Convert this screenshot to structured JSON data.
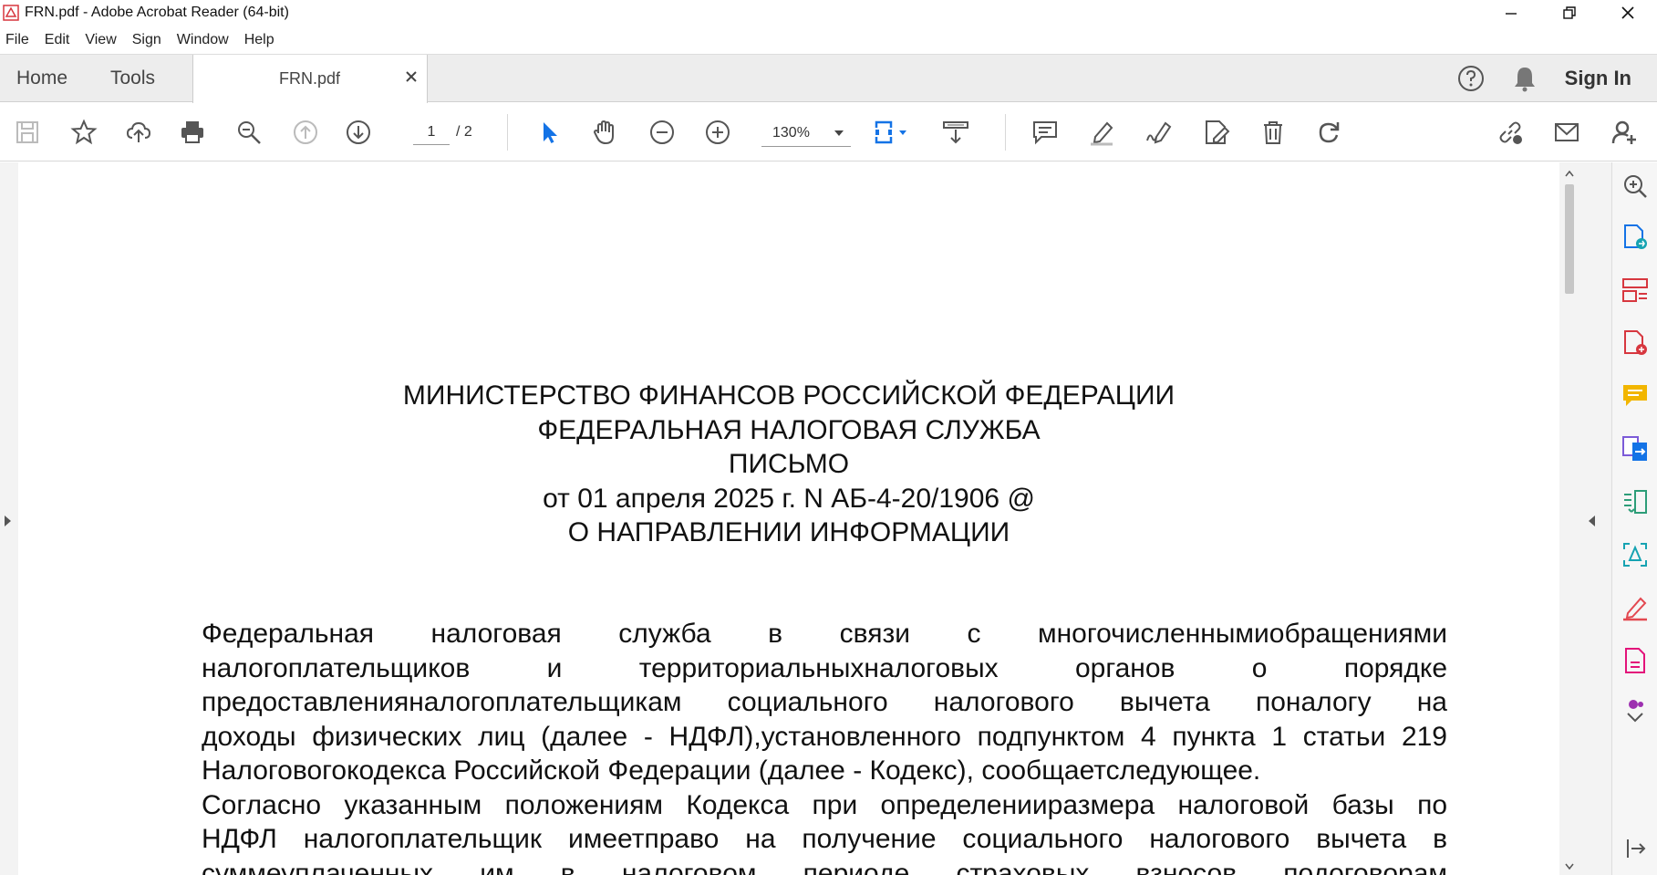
{
  "window": {
    "title": "FRN.pdf - Adobe Acrobat Reader (64-bit)"
  },
  "menu": [
    "File",
    "Edit",
    "View",
    "Sign",
    "Window",
    "Help"
  ],
  "tabs": {
    "home": "Home",
    "tools": "Tools",
    "document": "FRN.pdf",
    "sign_in": "Sign In"
  },
  "toolbar": {
    "page_current": "1",
    "page_total": "/ 2",
    "zoom": "130%"
  },
  "document": {
    "heading_lines": [
      "МИНИСТЕРСТВО ФИНАНСОВ РОССИЙСКОЙ ФЕДЕРАЦИИ",
      "ФЕДЕРАЛЬНАЯ НАЛОГОВАЯ СЛУЖБА",
      "ПИСЬМО",
      "от 01 апреля 2025 г. N АБ-4-20/1906 @",
      "О НАПРАВЛЕНИИ ИНФОРМАЦИИ"
    ],
    "body_lines": [
      "Федеральная налоговая служба в связи с многочисленнымиобращениями",
      "налогоплательщиков и территориальныхналоговых органов о порядке",
      "предоставленияналогоплательщикам социального налогового вычета поналогу на",
      "доходы физических лиц (далее - НДФЛ),установленного подпунктом 4 пункта 1 статьи 219",
      "Налоговогокодекса Российской Федерации (далее - Кодекс), сообщаетследующее.",
      "Согласно указанным положениям Кодекса при определенииразмера налоговой базы по",
      "НДФЛ налогоплательщик имеетправо на получение социального налогового вычета в",
      "суммеуплаченных им в налоговом периоде страховых взносов подоговорам"
    ]
  },
  "icons": {
    "accent": "#1473e6",
    "share_red": "#d7373f"
  }
}
